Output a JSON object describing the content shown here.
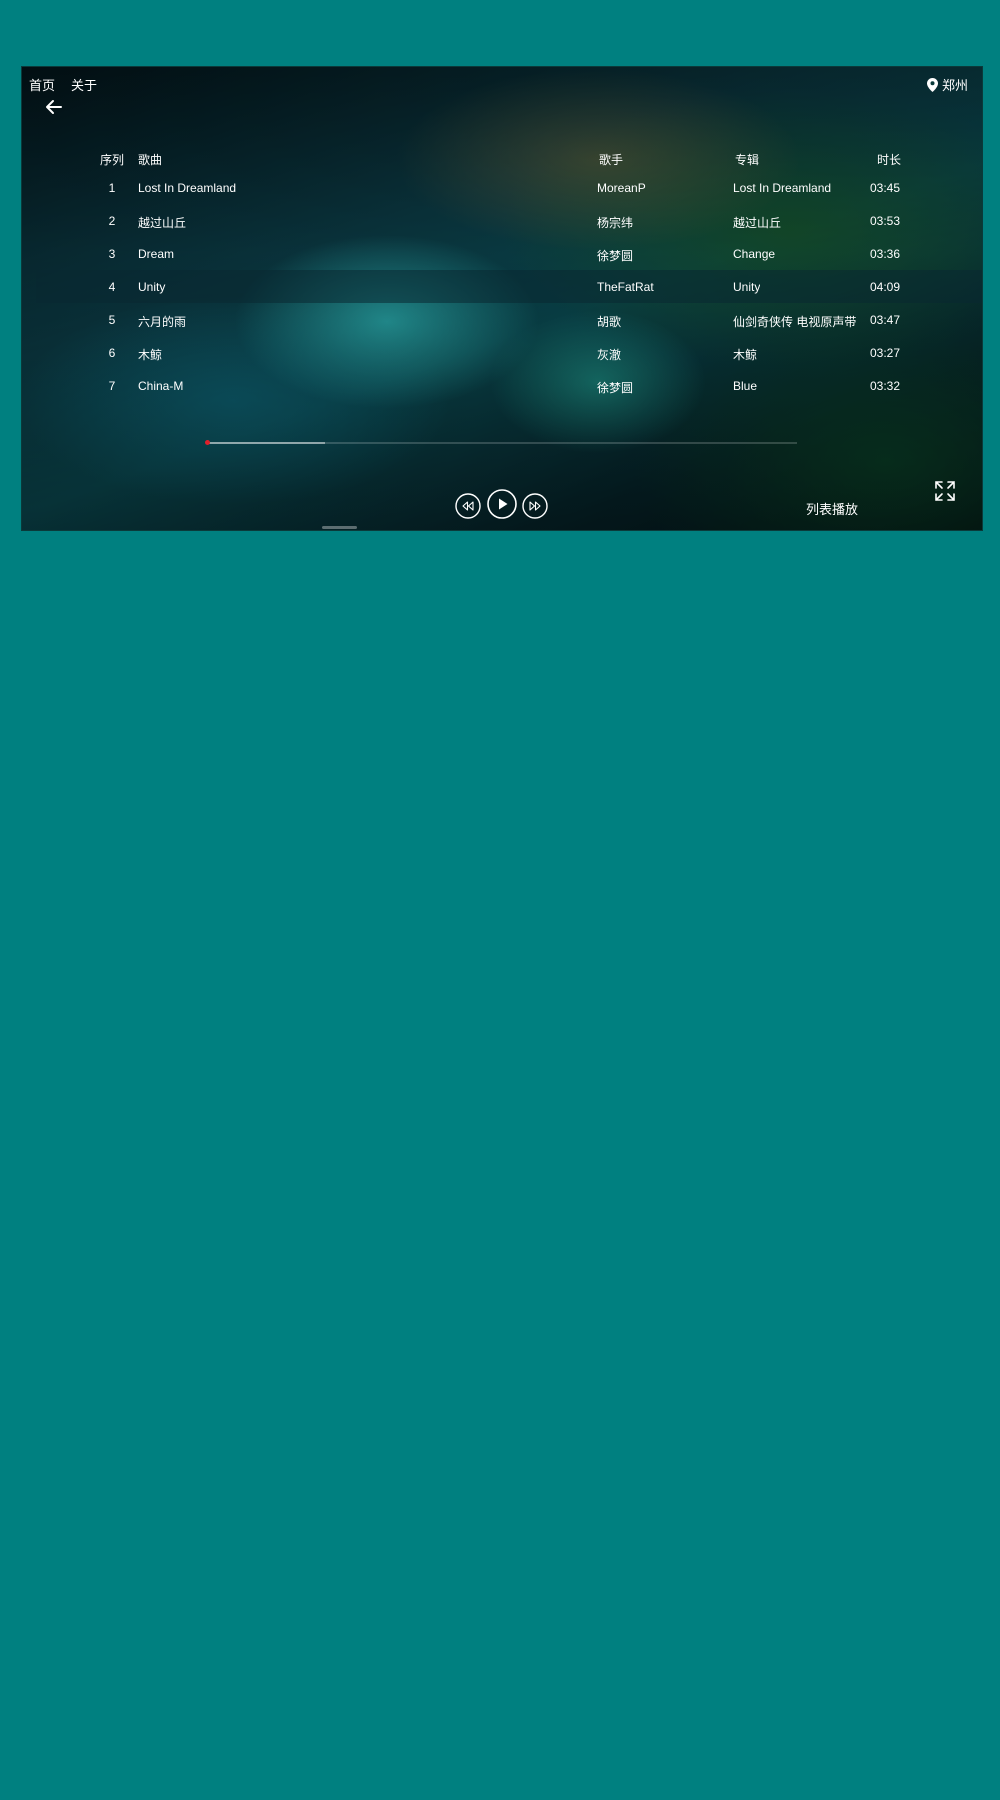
{
  "nav": {
    "home": "首页",
    "about": "关于"
  },
  "location": {
    "city": "郑州",
    "icon": "map-pin-icon"
  },
  "table": {
    "headers": {
      "index": "序列",
      "song": "歌曲",
      "artist": "歌手",
      "album": "专辑",
      "duration": "时长"
    },
    "rows": [
      {
        "index": "1",
        "song": "Lost In Dreamland",
        "artist": "MoreanP",
        "album": "Lost In Dreamland",
        "duration": "03:45"
      },
      {
        "index": "2",
        "song": "越过山丘",
        "artist": "杨宗纬",
        "album": "越过山丘",
        "duration": "03:53"
      },
      {
        "index": "3",
        "song": "Dream",
        "artist": "徐梦圆",
        "album": "Change",
        "duration": "03:36"
      },
      {
        "index": "4",
        "song": "Unity",
        "artist": "TheFatRat",
        "album": "Unity",
        "duration": "04:09"
      },
      {
        "index": "5",
        "song": "六月的雨",
        "artist": "胡歌",
        "album": "仙剑奇侠传 电视原声带",
        "duration": "03:47"
      },
      {
        "index": "6",
        "song": "木鲸",
        "artist": "灰澈",
        "album": "木鲸",
        "duration": "03:27"
      },
      {
        "index": "7",
        "song": "China-M",
        "artist": "徐梦圆",
        "album": "Blue",
        "duration": "03:32"
      }
    ],
    "active_row": 4
  },
  "player": {
    "progress": 0.2,
    "play_mode": "列表播放",
    "icons": [
      "back-arrow-icon",
      "rewind-icon",
      "play-icon",
      "fast-forward-icon",
      "fullscreen-icon"
    ]
  },
  "colors": {
    "page_bg": "#008080",
    "progress_knob": "#e0202a",
    "text": "#ffffff"
  }
}
